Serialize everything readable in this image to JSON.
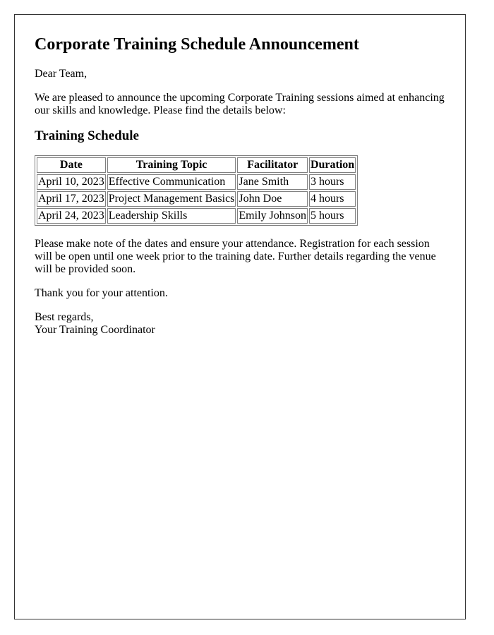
{
  "document": {
    "title": "Corporate Training Schedule Announcement",
    "greeting": "Dear Team,",
    "intro": "We are pleased to announce the upcoming Corporate Training sessions aimed at enhancing our skills and knowledge. Please find the details below:",
    "section_heading": "Training Schedule",
    "table": {
      "headers": [
        "Date",
        "Training Topic",
        "Facilitator",
        "Duration"
      ],
      "rows": [
        [
          "April 10, 2023",
          "Effective Communication",
          "Jane Smith",
          "3 hours"
        ],
        [
          "April 17, 2023",
          "Project Management Basics",
          "John Doe",
          "4 hours"
        ],
        [
          "April 24, 2023",
          "Leadership Skills",
          "Emily Johnson",
          "5 hours"
        ]
      ]
    },
    "note": "Please make note of the dates and ensure your attendance. Registration for each session will be open until one week prior to the training date. Further details regarding the venue will be provided soon.",
    "thanks": "Thank you for your attention.",
    "closing_line": "Best regards,",
    "signature": "Your Training Coordinator"
  }
}
